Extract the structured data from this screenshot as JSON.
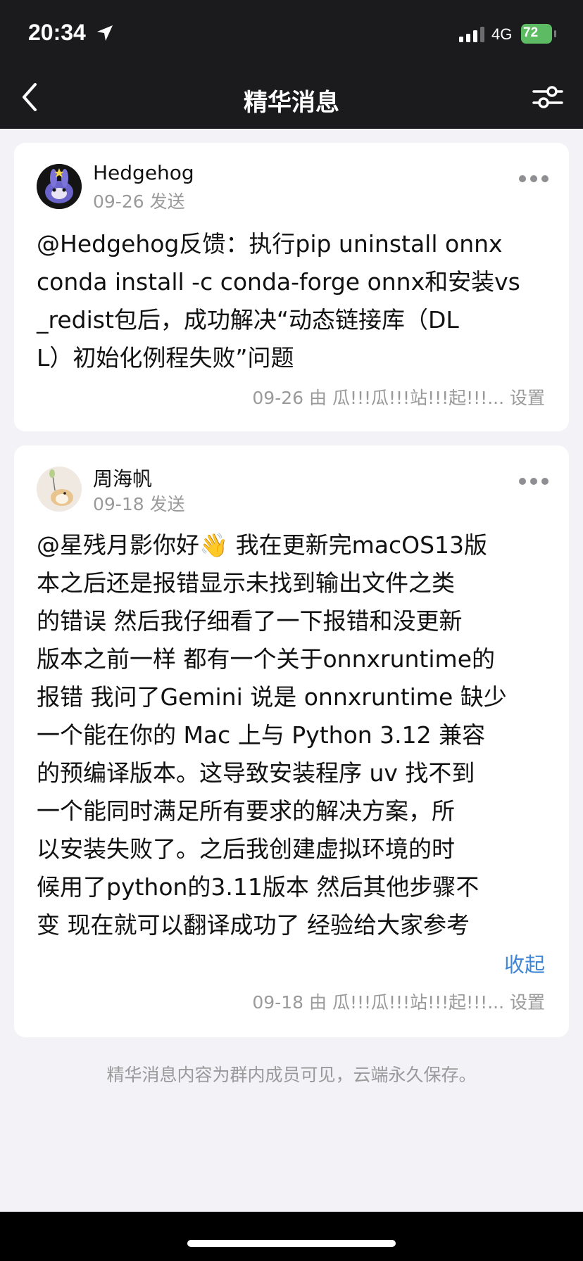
{
  "status_bar": {
    "time": "20:34",
    "network": "4G",
    "battery": "72"
  },
  "nav": {
    "title": "精华消息",
    "icons": [
      "chevron-left-icon",
      "filter-sliders-icon"
    ]
  },
  "posts": [
    {
      "author": "Hedgehog",
      "date": "09-26 发送",
      "lines": [
        "@Hedgehog反馈：执行pip uninstall onnx",
        "conda install -c conda-forge onnx和安装vs",
        "_redist包后，成功解决“动态链接库（DL",
        "L）初始化例程失败”问题"
      ],
      "footer": "09-26 由 瓜!!!瓜!!!站!!!起!!!... 设置"
    },
    {
      "author": "周海帆",
      "date": "09-18 发送",
      "lines": [
        "@星残月影你好👋 我在更新完macOS13版",
        "本之后还是报错显示未找到输出文件之类",
        "的错误 然后我仔细看了一下报错和没更新",
        "版本之前一样 都有一个关于onnxruntime的",
        "报错 我问了Gemini 说是 onnxruntime 缺少",
        "一个能在你的 Mac 上与 Python 3.12 兼容",
        "的预编译版本。这导致安装程序 uv 找不到",
        "一个能同时满足所有要求的解决方案，所",
        "以安装失败了。之后我创建虚拟环境的时",
        "候用了python的3.11版本 然后其他步骤不",
        "变 现在就可以翻译成功了 经验给大家参考"
      ],
      "collapse_label": "收起",
      "footer": "09-18 由 瓜!!!瓜!!!站!!!起!!!... 设置"
    }
  ],
  "note": "精华消息内容为群内成员可见，云端永久保存。",
  "colors": {
    "header_bg": "#1b1b1d",
    "page_bg": "#f2f2f7",
    "link_blue": "#3f86d6",
    "battery_green": "#5dbb63"
  }
}
